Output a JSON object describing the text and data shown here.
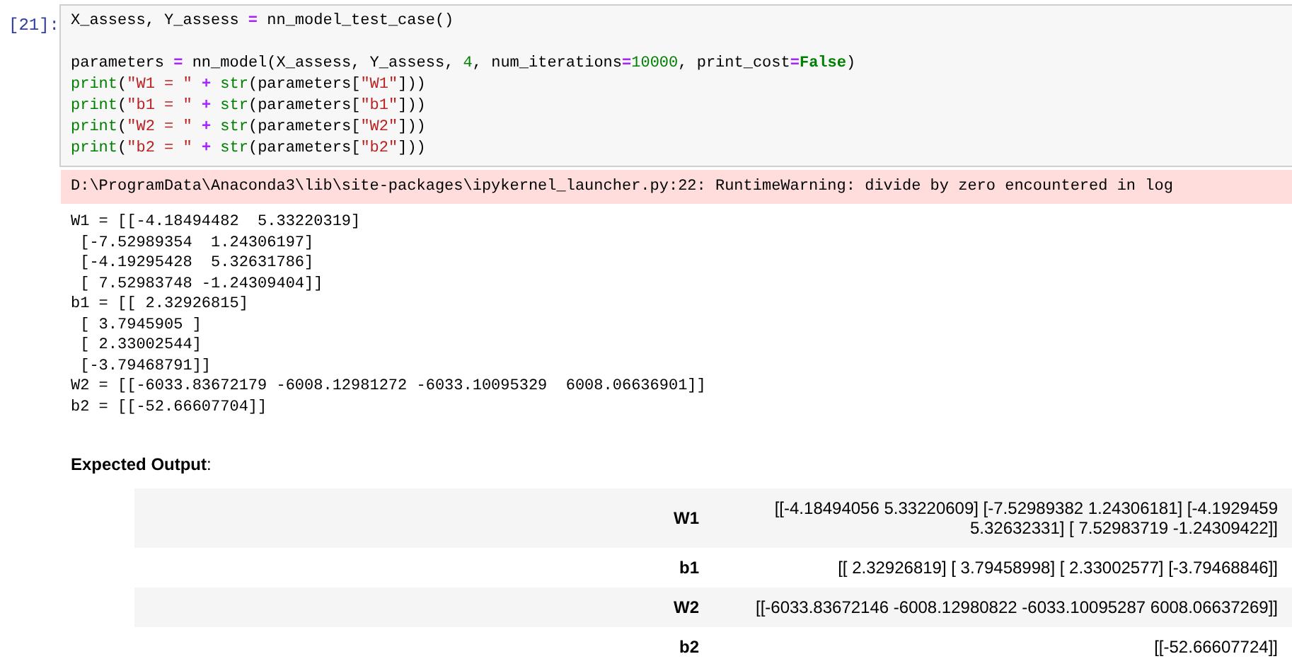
{
  "cell": {
    "prompt": "[21]:",
    "code_blocks": [
      [
        [
          {
            "text": "X_assess, Y_assess ",
            "kind": "plain"
          },
          {
            "text": "=",
            "kind": "op"
          },
          {
            "text": " nn_model_test_case()",
            "kind": "plain"
          }
        ]
      ],
      [
        [
          {
            "text": "parameters ",
            "kind": "plain"
          },
          {
            "text": "=",
            "kind": "op"
          },
          {
            "text": " nn_model(X_assess, Y_assess, ",
            "kind": "plain"
          },
          {
            "text": "4",
            "kind": "num"
          },
          {
            "text": ", num_iterations",
            "kind": "plain"
          },
          {
            "text": "=",
            "kind": "op"
          },
          {
            "text": "10000",
            "kind": "num"
          },
          {
            "text": ", print_cost",
            "kind": "plain"
          },
          {
            "text": "=",
            "kind": "op"
          },
          {
            "text": "False",
            "kind": "keyword"
          },
          {
            "text": ")",
            "kind": "plain"
          }
        ],
        [
          {
            "text": "print",
            "kind": "builtin"
          },
          {
            "text": "(",
            "kind": "plain"
          },
          {
            "text": "\"W1 = \"",
            "kind": "string"
          },
          {
            "text": " + ",
            "kind": "op"
          },
          {
            "text": "str",
            "kind": "builtin"
          },
          {
            "text": "(parameters[",
            "kind": "plain"
          },
          {
            "text": "\"W1\"",
            "kind": "string"
          },
          {
            "text": "]))",
            "kind": "plain"
          }
        ],
        [
          {
            "text": "print",
            "kind": "builtin"
          },
          {
            "text": "(",
            "kind": "plain"
          },
          {
            "text": "\"b1 = \"",
            "kind": "string"
          },
          {
            "text": " + ",
            "kind": "op"
          },
          {
            "text": "str",
            "kind": "builtin"
          },
          {
            "text": "(parameters[",
            "kind": "plain"
          },
          {
            "text": "\"b1\"",
            "kind": "string"
          },
          {
            "text": "]))",
            "kind": "plain"
          }
        ],
        [
          {
            "text": "print",
            "kind": "builtin"
          },
          {
            "text": "(",
            "kind": "plain"
          },
          {
            "text": "\"W2 = \"",
            "kind": "string"
          },
          {
            "text": " + ",
            "kind": "op"
          },
          {
            "text": "str",
            "kind": "builtin"
          },
          {
            "text": "(parameters[",
            "kind": "plain"
          },
          {
            "text": "\"W2\"",
            "kind": "string"
          },
          {
            "text": "]))",
            "kind": "plain"
          }
        ],
        [
          {
            "text": "print",
            "kind": "builtin"
          },
          {
            "text": "(",
            "kind": "plain"
          },
          {
            "text": "\"b2 = \"",
            "kind": "string"
          },
          {
            "text": " + ",
            "kind": "op"
          },
          {
            "text": "str",
            "kind": "builtin"
          },
          {
            "text": "(parameters[",
            "kind": "plain"
          },
          {
            "text": "\"b2\"",
            "kind": "string"
          },
          {
            "text": "]))",
            "kind": "plain"
          }
        ]
      ]
    ],
    "stderr": "D:\\ProgramData\\Anaconda3\\lib\\site-packages\\ipykernel_launcher.py:22: RuntimeWarning: divide by zero encountered in log",
    "stdout": [
      "W1 = [[-4.18494482  5.33220319]",
      " [-7.52989354  1.24306197]",
      " [-4.19295428  5.32631786]",
      " [ 7.52983748 -1.24309404]]",
      "b1 = [[ 2.32926815]",
      " [ 3.7945905 ]",
      " [ 2.33002544]",
      " [-3.79468791]]",
      "W2 = [[-6033.83672179 -6008.12981272 -6033.10095329  6008.06636901]]",
      "b2 = [[-52.66607704]]"
    ]
  },
  "expected": {
    "heading": "**Expected Output**:",
    "rows": [
      {
        "label": "W1",
        "value": "[[-4.18494056 5.33220609] [-7.52989382 1.24306181] [-4.1929459 5.32632331] [ 7.52983719 -1.24309422]]"
      },
      {
        "label": "b1",
        "value": "[[ 2.32926819] [ 3.79458998] [ 2.33002577] [-3.79468846]]"
      },
      {
        "label": "W2",
        "value": "[[-6033.83672146 -6008.12980822 -6033.10095287 6008.06637269]]"
      },
      {
        "label": "b2",
        "value": "[[-52.66607724]]"
      }
    ]
  }
}
